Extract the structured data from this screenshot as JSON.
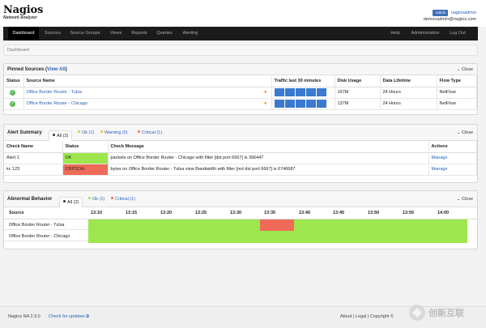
{
  "header": {
    "logo": "Nagios",
    "logo_sub": "Network Analyzer",
    "admin_badge": "Admin",
    "username": "nagiosadmin",
    "email": "democadmin@nagios.com"
  },
  "nav": {
    "items": [
      "Dashboard",
      "Sources",
      "Source Groups",
      "Views",
      "Reports",
      "Queries",
      "Alerting"
    ],
    "right": [
      "Help",
      "Administration",
      "Log Out"
    ]
  },
  "breadcrumb": "Dashboard",
  "pinned": {
    "title": "Pinned Sources",
    "view_all": "View All",
    "close": "Close",
    "columns": [
      "Status",
      "Source Name",
      "Traffic last 30 minutes",
      "Disk Usage",
      "Data Lifetime",
      "Flow Type"
    ],
    "rows": [
      {
        "name": "Office Border Router - Tulsa",
        "disk": "167M",
        "lifetime": "24 Hours",
        "flow": "NetFlow"
      },
      {
        "name": "Office Border Router - Chicago",
        "disk": "137M",
        "lifetime": "24 Hours",
        "flow": "NetFlow"
      }
    ]
  },
  "alerts": {
    "title": "Alert Summary",
    "close": "Close",
    "tabs": [
      "All (2)",
      "Ok (1)",
      "Warning (0)",
      "Critical (1)"
    ],
    "tab_colors": [
      "#333333",
      "#9ee64d",
      "#f0c419",
      "#ef6b58"
    ],
    "columns": [
      "Check Name",
      "Status",
      "Check Message",
      "Actions"
    ],
    "rows": [
      {
        "name": "Alert 1",
        "status": "OK",
        "message": "packets on Office Border Router - Chicago with filter [dst port 6667] is 396447",
        "action": "Manage"
      },
      {
        "name": "kc 123",
        "status": "CRITICAL",
        "message": "bytes on Office Border Router - Tulsa view Bandwidth with filter [not dst port 6667] is 6746687",
        "action": "Manage"
      }
    ]
  },
  "abnormal": {
    "title": "Abnormal Behavior",
    "close": "Close",
    "tabs": [
      "All (2)",
      "Ok (1)",
      "Critical (1)"
    ],
    "tab_colors": [
      "#333333",
      "#9ee64d",
      "#ef6b58"
    ],
    "source_header": "Source",
    "times": [
      "13:10",
      "13:15",
      "13:20",
      "13:25",
      "13:30",
      "13:35",
      "13:40",
      "13:45",
      "13:50",
      "13:55",
      "14:00"
    ],
    "rows": [
      "Office Border Router - Tulsa",
      "Office Border Router - Chicago"
    ]
  },
  "footer": {
    "version": "Nagios NA 2.3.0",
    "updates": "Check for updates",
    "links": "About  |  Legal  |  Copyright ©"
  },
  "watermark": "创新互联",
  "colors": {
    "ok": "#9ee64d",
    "critical": "#ef6b58",
    "accent": "#2a63b8"
  }
}
